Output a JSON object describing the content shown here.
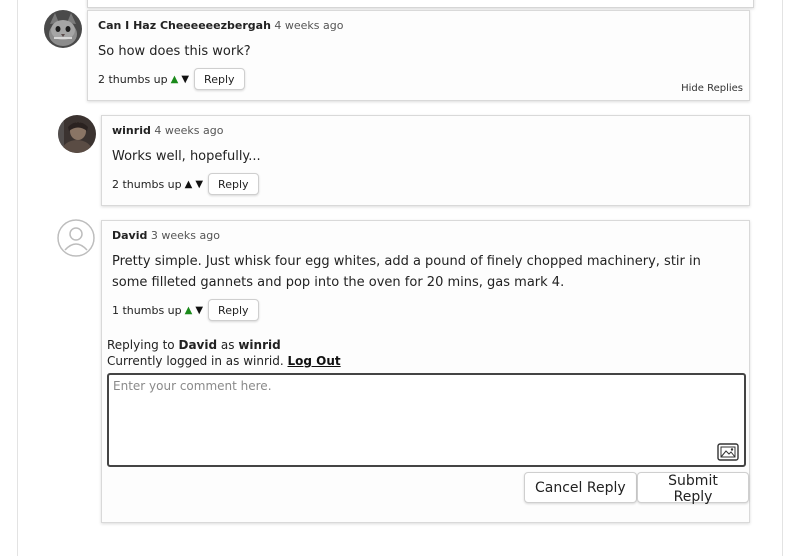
{
  "comments": [
    {
      "author": "Can I Haz Cheeeeeezbergah",
      "time": "4 weeks ago",
      "text": "So how does this work?",
      "thumbs": "2 thumbs up",
      "reply_label": "Reply",
      "hide_replies": "Hide Replies"
    },
    {
      "author": "winrid",
      "time": "4 weeks ago",
      "text": "Works well, hopefully...",
      "thumbs": "2 thumbs up",
      "reply_label": "Reply"
    },
    {
      "author": "David",
      "time": "3 weeks ago",
      "text": "Pretty simple. Just whisk four egg whites, add a pound of finely chopped machinery, stir in some filleted gannets and pop into the oven for 20 mins, gas mark 4.",
      "thumbs": "1 thumbs up",
      "reply_label": "Reply"
    }
  ],
  "reply_box": {
    "replying_to_prefix": "Replying to",
    "replying_to_user": "David",
    "as_word": "as",
    "as_user": "winrid",
    "logged_in_text": "Currently logged in as winrid.",
    "logout_label": "Log Out",
    "placeholder": "Enter your comment here.",
    "cancel_label": "Cancel Reply",
    "submit_label": "Submit Reply"
  },
  "icons": {
    "upvote": "▲",
    "downvote": "▼"
  },
  "colors": {
    "upvote_active": "#1a8a1a",
    "arrow_default": "#111111"
  }
}
